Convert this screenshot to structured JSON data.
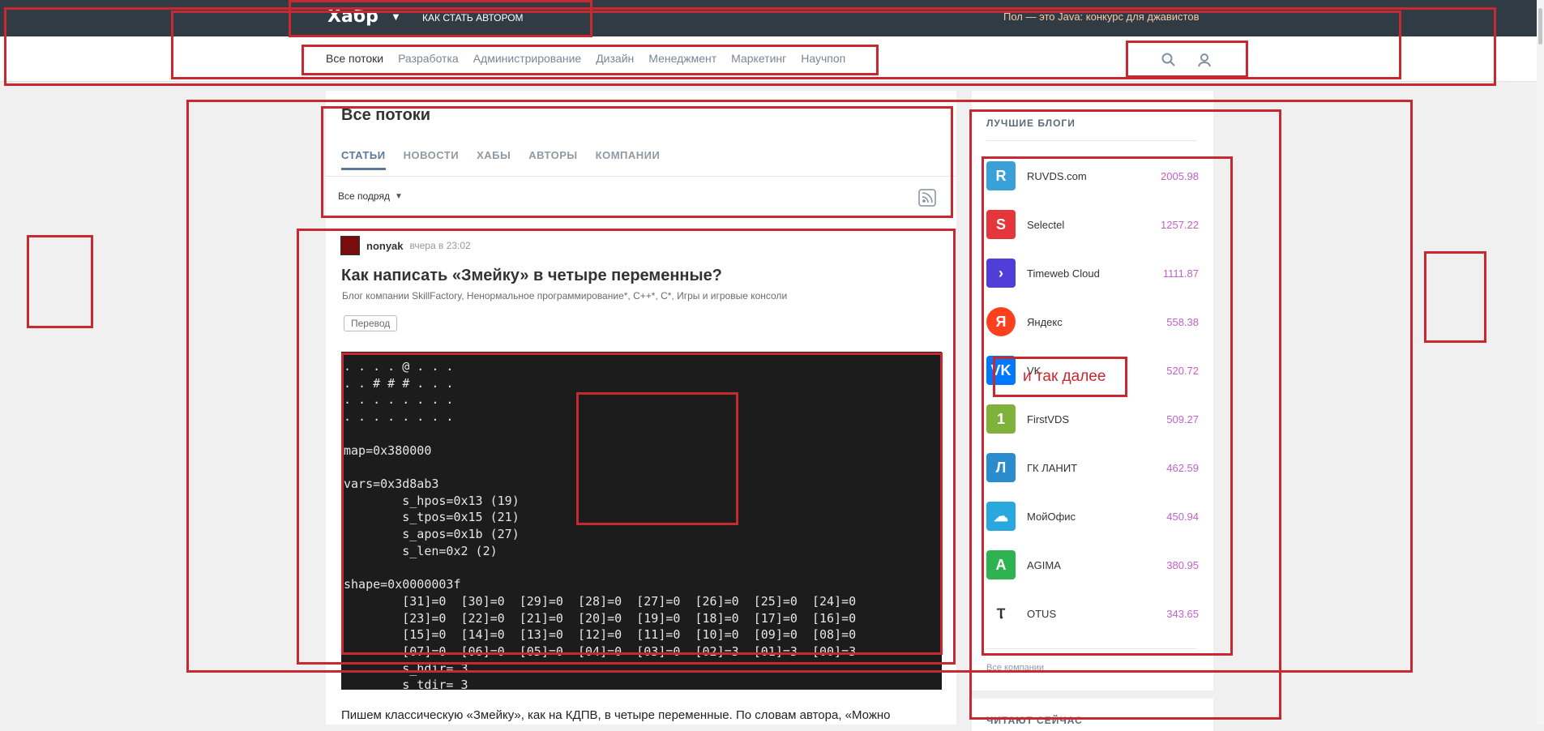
{
  "header": {
    "logo": "Хабр",
    "become_author": "Как стать автором",
    "promo": "Пол — это Java: конкурс для джавистов"
  },
  "nav": {
    "items": [
      {
        "label": "Все потоки",
        "active": true
      },
      {
        "label": "Разработка"
      },
      {
        "label": "Администрирование"
      },
      {
        "label": "Дизайн"
      },
      {
        "label": "Менеджмент"
      },
      {
        "label": "Маркетинг"
      },
      {
        "label": "Научпоп"
      }
    ],
    "search_icon": "search-icon",
    "user_icon": "user-icon"
  },
  "feed": {
    "title": "Все потоки",
    "tabs": [
      "СТАТЬИ",
      "НОВОСТИ",
      "ХАБЫ",
      "АВТОРЫ",
      "КОМПАНИИ"
    ],
    "filter": "Все подряд",
    "rss_icon": "rss-icon"
  },
  "post": {
    "author": "nonyak",
    "time": "вчера в 23:02",
    "title": "Как написать «Змейку» в четыре переменные?",
    "hubs": "Блог компании SkillFactory, Ненормальное программирование*, C++*, C*, Игры и игровые консоли",
    "badge": "Перевод",
    "code_lines": [
      ". . . . @ . . .",
      ". . # # # . . .",
      ". . . . . . . .",
      ". . . . . . . .",
      "",
      "map=0x380000",
      "",
      "vars=0x3d8ab3",
      "        s_hpos=0x13 (19)",
      "        s_tpos=0x15 (21)",
      "        s_apos=0x1b (27)",
      "        s_len=0x2 (2)",
      "",
      "shape=0x0000003f",
      "        [31]=0  [30]=0  [29]=0  [28]=0  [27]=0  [26]=0  [25]=0  [24]=0",
      "        [23]=0  [22]=0  [21]=0  [20]=0  [19]=0  [18]=0  [17]=0  [16]=0",
      "        [15]=0  [14]=0  [13]=0  [12]=0  [11]=0  [10]=0  [09]=0  [08]=0",
      "        [07]=0  [06]=0  [05]=0  [04]=0  [03]=0  [02]=3  [01]=3  [00]=3",
      "        s_hdir= 3",
      "        s_tdir= 3"
    ],
    "lead": "Пишем классическую «Змейку», как на КДПВ, в четыре переменные. По словам автора, «Можно"
  },
  "sidebar": {
    "title": "ЛУЧШИЕ БЛОГИ",
    "blogs": [
      {
        "name": "RUVDS.com",
        "rating": "2005.98",
        "icon": "ruvds-logo-icon",
        "color": "#3aa0d8",
        "glyph": "R"
      },
      {
        "name": "Selectel",
        "rating": "1257.22",
        "icon": "selectel-logo-icon",
        "color": "#e5363c",
        "glyph": "S"
      },
      {
        "name": "Timeweb Cloud",
        "rating": "1111.87",
        "icon": "timeweb-logo-icon",
        "color": "#4f3ed7",
        "glyph": "›"
      },
      {
        "name": "Яндекс",
        "rating": "558.38",
        "icon": "yandex-logo-icon",
        "color": "#fc3f1d",
        "glyph": "Я"
      },
      {
        "name": "VK",
        "rating": "520.72",
        "icon": "vk-logo-icon",
        "color": "#0077ff",
        "glyph": "VK"
      },
      {
        "name": "FirstVDS",
        "rating": "509.27",
        "icon": "firstvds-logo-icon",
        "color": "#7fb23b",
        "glyph": "1"
      },
      {
        "name": "ГК ЛАНИТ",
        "rating": "462.59",
        "icon": "lanit-logo-icon",
        "color": "#2a8ccd",
        "glyph": "Л"
      },
      {
        "name": "МойОфис",
        "rating": "450.94",
        "icon": "myoffice-logo-icon",
        "color": "#29a8e0",
        "glyph": "☁"
      },
      {
        "name": "AGIMA",
        "rating": "380.95",
        "icon": "agima-logo-icon",
        "color": "#2fb351",
        "glyph": "A"
      },
      {
        "name": "OTUS",
        "rating": "343.65",
        "icon": "otus-logo-icon",
        "color": "#ffffff",
        "glyph": "Ⲧ"
      }
    ],
    "all_companies": "Все компании",
    "reading_now": "ЧИТАЮТ СЕЙЧАС"
  },
  "annotation": "и так далее",
  "colors": {
    "annotation": "#c8282f",
    "rating": "#c261c8",
    "topbar": "#303b44"
  }
}
